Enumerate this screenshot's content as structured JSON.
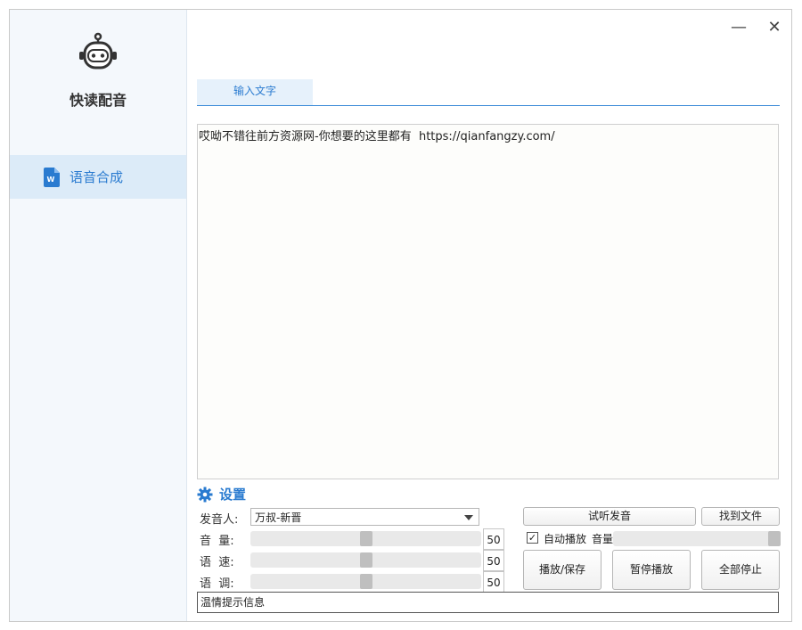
{
  "app": {
    "title": "快读配音"
  },
  "sidebar": {
    "items": [
      {
        "label": "语音合成",
        "icon": "word-document-icon",
        "active": true
      }
    ]
  },
  "window_controls": {
    "minimize": "—",
    "close": "✕"
  },
  "tabs": [
    {
      "label": "输入文字",
      "active": true
    }
  ],
  "editor": {
    "text": "哎呦不错往前方资源网-你想要的这里都有  https://qianfangzy.com/"
  },
  "settings": {
    "title": "设置",
    "voice": {
      "label": "发音人:",
      "value": "万叔-新晋"
    },
    "volume": {
      "label": "音  量:",
      "value": 50,
      "display": "50"
    },
    "speed": {
      "label": "语  速:",
      "value": 50,
      "display": "50"
    },
    "pitch": {
      "label": "语  调:",
      "value": 50,
      "display": "50"
    },
    "buttons": {
      "preview": "试听发音",
      "find_file": "找到文件",
      "play_save": "播放/保存",
      "pause": "暂停播放",
      "stop_all": "全部停止"
    },
    "autoplay": {
      "label": "自动播放",
      "checked": true
    },
    "playback_volume": {
      "label": "音量",
      "value": 100
    }
  },
  "status": {
    "text": "温情提示信息"
  },
  "colors": {
    "accent": "#2a7bd0",
    "sidebar_bg": "#f4f8fc",
    "active_nav_bg": "#dcebf8"
  }
}
